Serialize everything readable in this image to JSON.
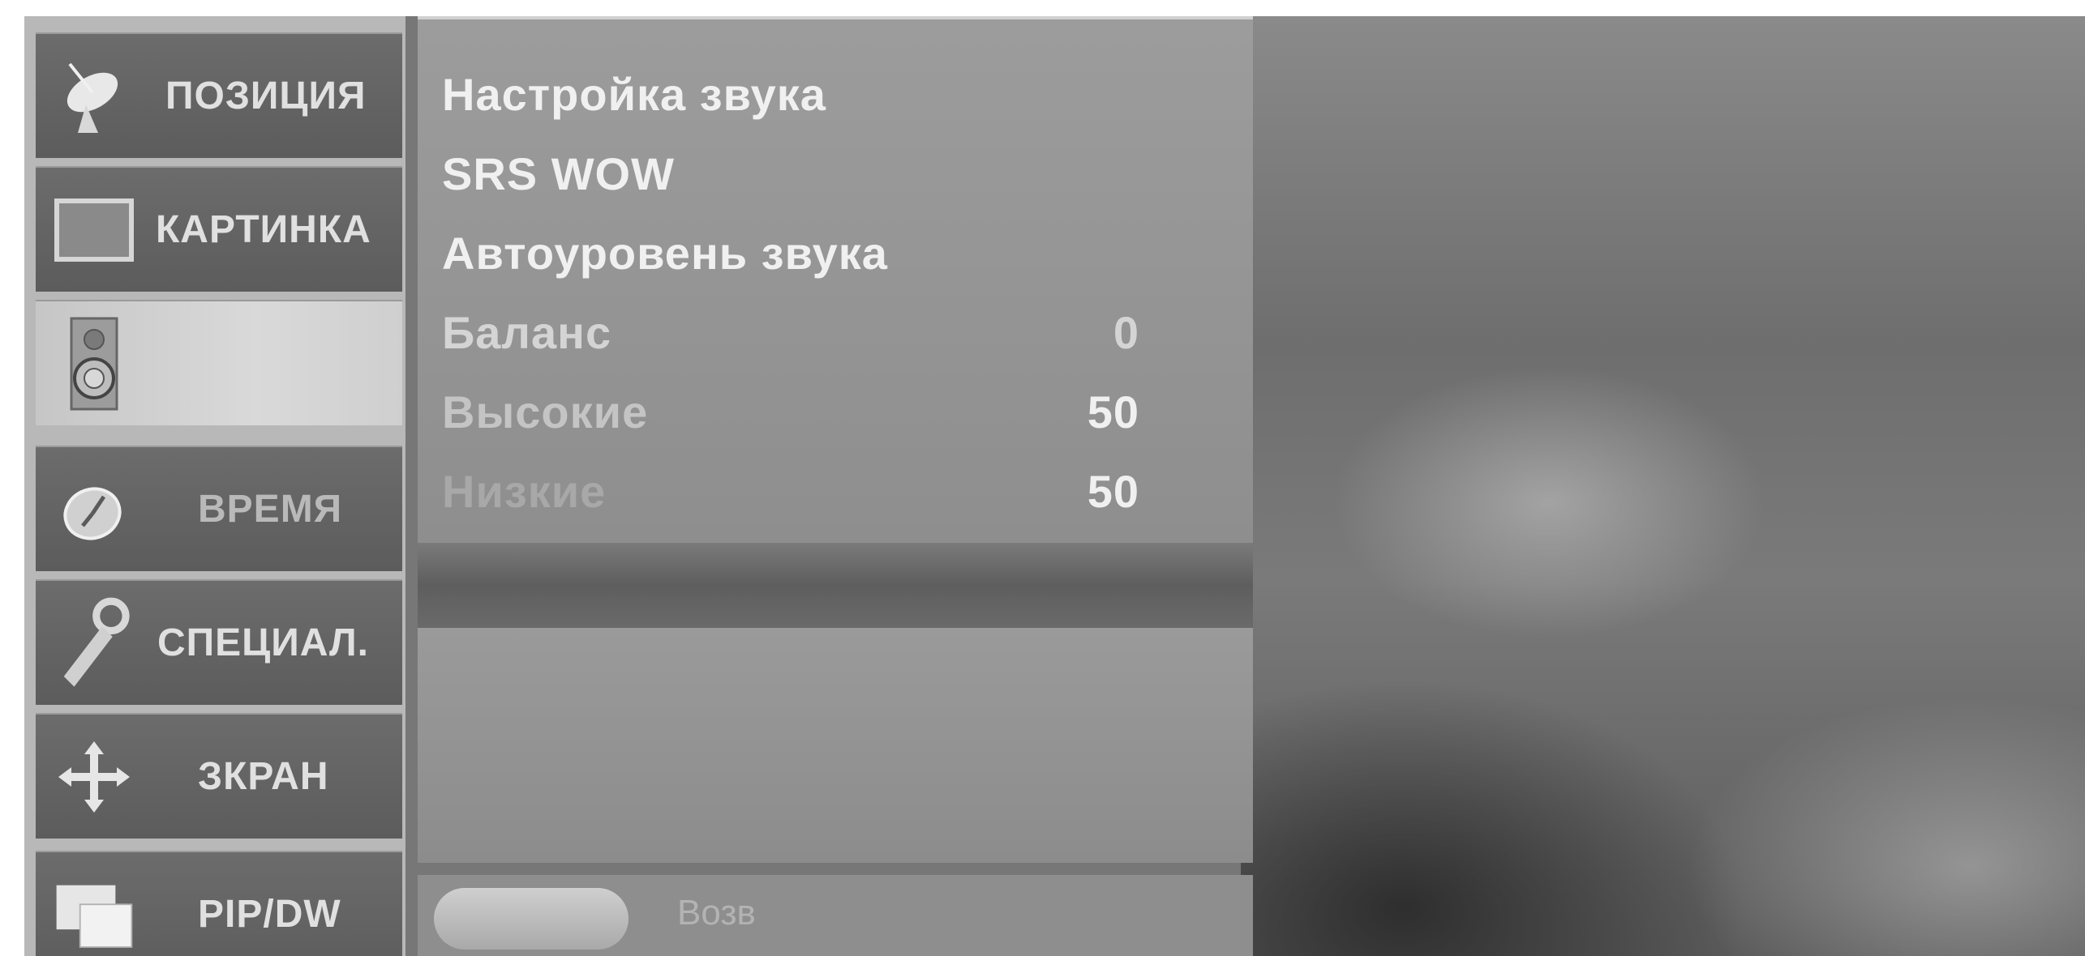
{
  "sidebar": {
    "items": [
      {
        "label": "ПОЗИЦИЯ",
        "icon": "satellite-dish-icon"
      },
      {
        "label": "КАРТИНКА",
        "icon": "picture-icon"
      },
      {
        "label": "",
        "icon": "speaker-icon"
      },
      {
        "label": "ВРЕМЯ",
        "icon": "clock-icon"
      },
      {
        "label": "СПЕЦИАЛ.",
        "icon": "key-icon"
      },
      {
        "label": "ЗКРАН",
        "icon": "move-arrows-icon"
      },
      {
        "label": "PIP/DW",
        "icon": "pip-icon"
      }
    ],
    "active_index": 2
  },
  "menu": {
    "items": [
      {
        "label": "Настройка звука",
        "value": ""
      },
      {
        "label": "SRS WOW",
        "value": ""
      },
      {
        "label": "Автоуровень звука",
        "value": ""
      },
      {
        "label": "Баланс",
        "value": "0"
      },
      {
        "label": "Высокие",
        "value": "50"
      },
      {
        "label": "Низкие",
        "value": "50"
      }
    ]
  },
  "bottom_bar": {
    "text": "Возв"
  },
  "colors": {
    "sidebar_item": "#626262",
    "sidebar_active": "#d0d0d0",
    "panel": "#959595",
    "text": "#f0f0f0"
  }
}
